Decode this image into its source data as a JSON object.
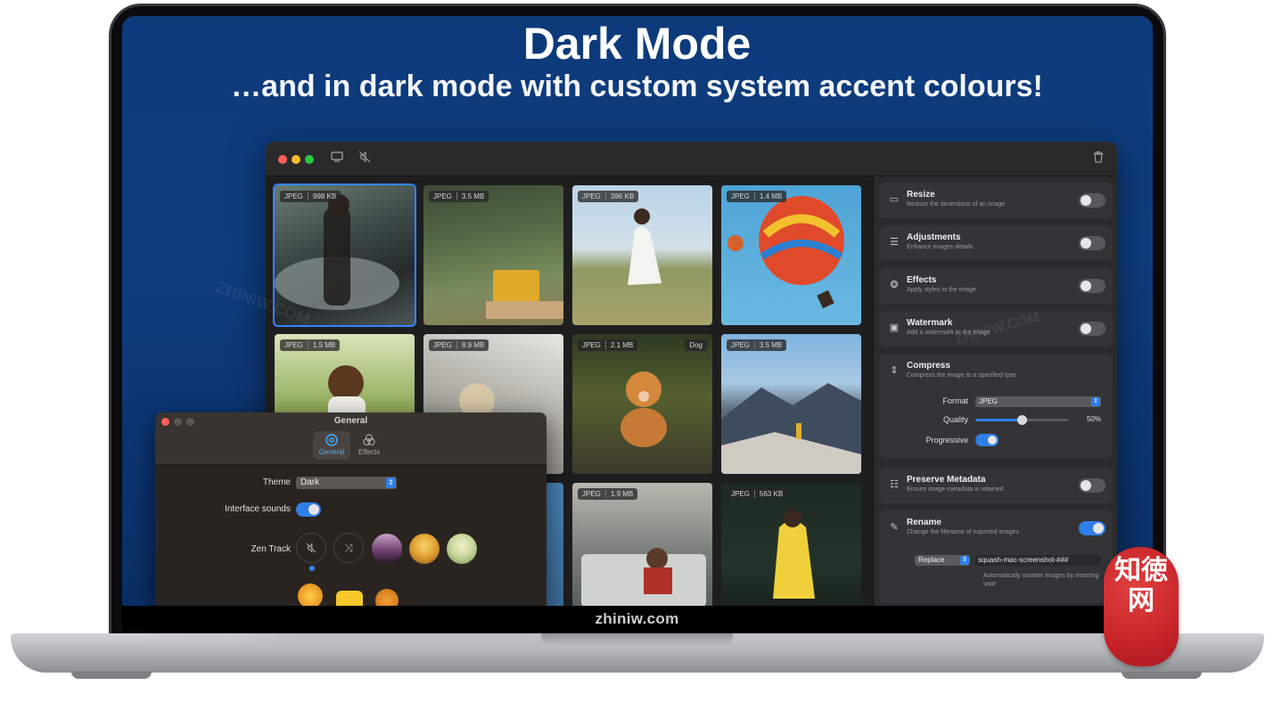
{
  "headline": "Dark Mode",
  "subline": "…and in dark mode with custom system accent colours!",
  "bezel_text": "zhiniw.com",
  "colors": {
    "accent": "#2f7fe9",
    "background": "#0e3d80",
    "window": "#1e1e1f",
    "panel": "#2b2b2d",
    "watermark_seal": "#c8242a"
  },
  "watermark": {
    "seal_text": "知徳网",
    "overlay_text": "ZHINIW.COM"
  },
  "app": {
    "titlebar_icons": [
      "display-icon",
      "mute-icon",
      "trash-icon"
    ],
    "images": [
      {
        "type": "JPEG",
        "size": "998 KB",
        "selected": true
      },
      {
        "type": "JPEG",
        "size": "3.5 MB"
      },
      {
        "type": "JPEG",
        "size": "396 KB"
      },
      {
        "type": "JPEG",
        "size": "1.4 MB"
      },
      {
        "type": "JPEG",
        "size": "1.5 MB"
      },
      {
        "type": "JPEG",
        "size": "8.9 MB"
      },
      {
        "type": "JPEG",
        "size": "2.1 MB",
        "tag": "Dog"
      },
      {
        "type": "JPEG",
        "size": "3.5 MB"
      },
      {
        "type": "JPEG",
        "size": "1.9 MB"
      },
      {
        "type": "JPEG",
        "size": "563 KB"
      }
    ],
    "panel": {
      "resize": {
        "title": "Resize",
        "subtitle": "Reduce the dimentions of an image",
        "enabled": false
      },
      "adjustments": {
        "title": "Adjustments",
        "subtitle": "Enhance images details",
        "enabled": false
      },
      "effects": {
        "title": "Effects",
        "subtitle": "Apply styles to the image",
        "enabled": false
      },
      "watermark": {
        "title": "Watermark",
        "subtitle": "Add a watermark to the image",
        "enabled": false
      },
      "compress": {
        "title": "Compress",
        "subtitle": "Compress the image to a specified type",
        "format_label": "Format",
        "format_value": "JPEG",
        "quality_label": "Quality",
        "quality_value": "50%",
        "quality_fraction": 0.5,
        "progressive_label": "Progressive",
        "progressive": true
      },
      "preserve_metadata": {
        "title": "Preserve Metadata",
        "subtitle": "Ensure image metadata is retained",
        "enabled": false
      },
      "rename": {
        "title": "Rename",
        "subtitle": "Change the filename of exported images",
        "enabled": true,
        "mode": "Replace",
        "pattern": "squash-mac-screenshot-###",
        "hint": "Automatically number images by inserting '###'"
      }
    }
  },
  "prefs": {
    "title": "General",
    "tabs": [
      {
        "label": "General",
        "active": true
      },
      {
        "label": "Effects",
        "active": false
      }
    ],
    "theme_label": "Theme",
    "theme_value": "Dark",
    "sounds_label": "Interface sounds",
    "sounds_on": true,
    "zen_label": "Zen Track"
  }
}
